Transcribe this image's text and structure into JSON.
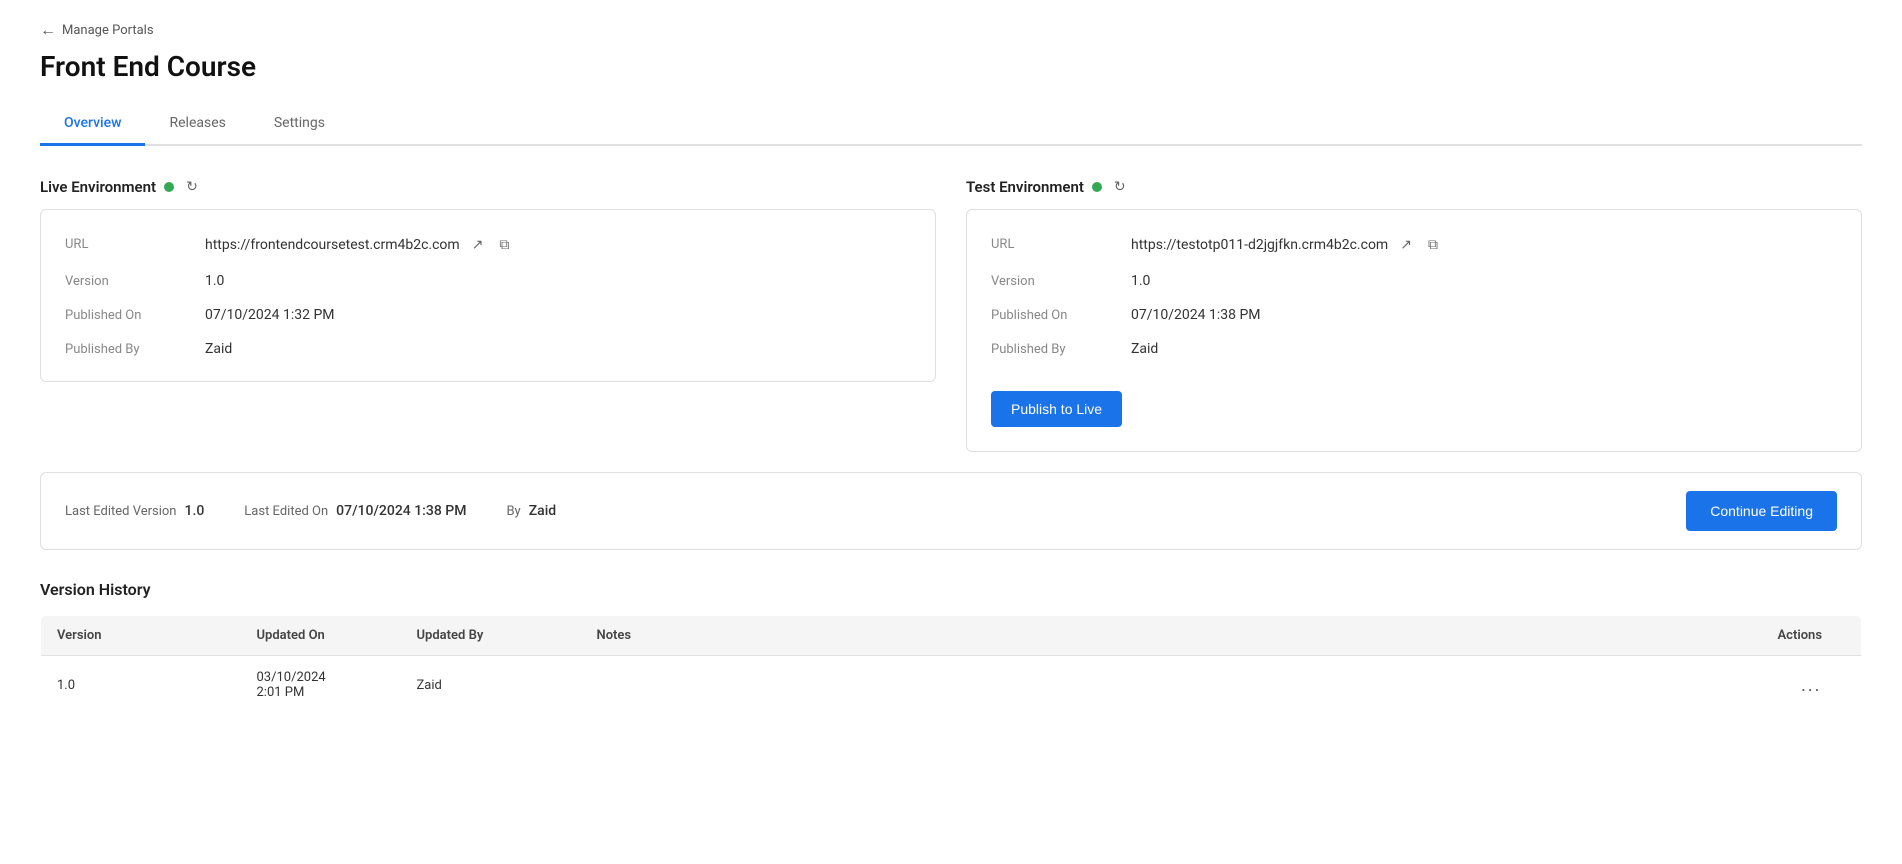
{
  "breadcrumb": {
    "back_label": "Manage Portals",
    "arrow": "←"
  },
  "page_title": "Front End Course",
  "tabs": [
    {
      "id": "overview",
      "label": "Overview",
      "active": true
    },
    {
      "id": "releases",
      "label": "Releases",
      "active": false
    },
    {
      "id": "settings",
      "label": "Settings",
      "active": false
    }
  ],
  "live_environment": {
    "title": "Live Environment",
    "status": "active",
    "refresh_icon": "↻",
    "url_label": "URL",
    "url_value": "https://frontendcoursetest.crm4b2c.com",
    "version_label": "Version",
    "version_value": "1.0",
    "published_on_label": "Published On",
    "published_on_value": "07/10/2024 1:32 PM",
    "published_by_label": "Published By",
    "published_by_value": "Zaid",
    "external_icon": "↗",
    "copy_icon": "⧉"
  },
  "test_environment": {
    "title": "Test Environment",
    "status": "active",
    "refresh_icon": "↻",
    "url_label": "URL",
    "url_value": "https://testotp011-d2jgjfkn.crm4b2c.com",
    "version_label": "Version",
    "version_value": "1.0",
    "published_on_label": "Published On",
    "published_on_value": "07/10/2024 1:38 PM",
    "published_by_label": "Published By",
    "published_by_value": "Zaid",
    "publish_btn_label": "Publish to Live",
    "external_icon": "↗",
    "copy_icon": "⧉"
  },
  "last_edited": {
    "version_label": "Last Edited Version",
    "version_value": "1.0",
    "on_label": "Last Edited On",
    "on_value": "07/10/2024 1:38 PM",
    "by_label": "By",
    "by_value": "Zaid",
    "continue_btn_label": "Continue Editing"
  },
  "version_history": {
    "title": "Version History",
    "columns": [
      {
        "id": "version",
        "label": "Version"
      },
      {
        "id": "updated_on",
        "label": "Updated On"
      },
      {
        "id": "updated_by",
        "label": "Updated By"
      },
      {
        "id": "notes",
        "label": "Notes"
      },
      {
        "id": "actions",
        "label": "Actions"
      }
    ],
    "rows": [
      {
        "version": "1.0",
        "updated_on": "03/10/2024\n2:01 PM",
        "updated_by": "Zaid",
        "notes": "",
        "actions": "..."
      }
    ]
  }
}
